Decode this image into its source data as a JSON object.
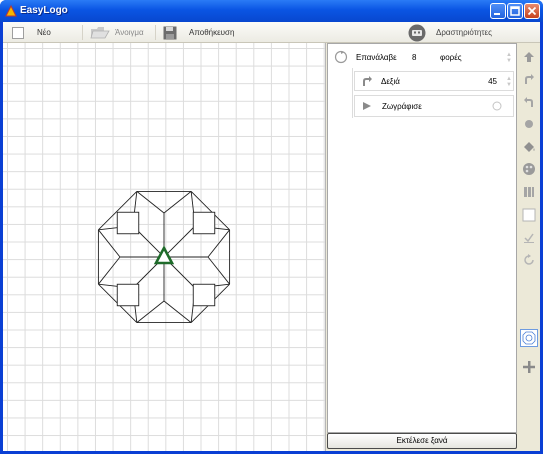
{
  "window": {
    "title": "EasyLogo"
  },
  "toolbar": {
    "new_label": "Νέο",
    "open_label": "Άνοιγμα",
    "save_label": "Αποθήκευση",
    "activities_label": "Δραστηριότητες"
  },
  "program": {
    "repeat": {
      "label": "Επανάλαβε",
      "count": "8",
      "unit": "φορές"
    },
    "right": {
      "label": "Δεξιά",
      "value": "45"
    },
    "draw": {
      "label": "Ζωγράφισε"
    }
  },
  "run_again_label": "Εκτέλεσε ξανά",
  "sidebar": {
    "icons": [
      "arrow-up-icon",
      "redo-icon",
      "undo-icon",
      "pen-dot-icon",
      "paint-bucket-icon",
      "color-palette-icon",
      "pause-icon",
      "blank-page-icon",
      "checkmark-icon",
      "refresh-icon",
      "grid-pattern-icon",
      "add-icon"
    ]
  },
  "colors": {
    "titlebar": "#0a55e3",
    "turtle": "#1e6b2a"
  }
}
